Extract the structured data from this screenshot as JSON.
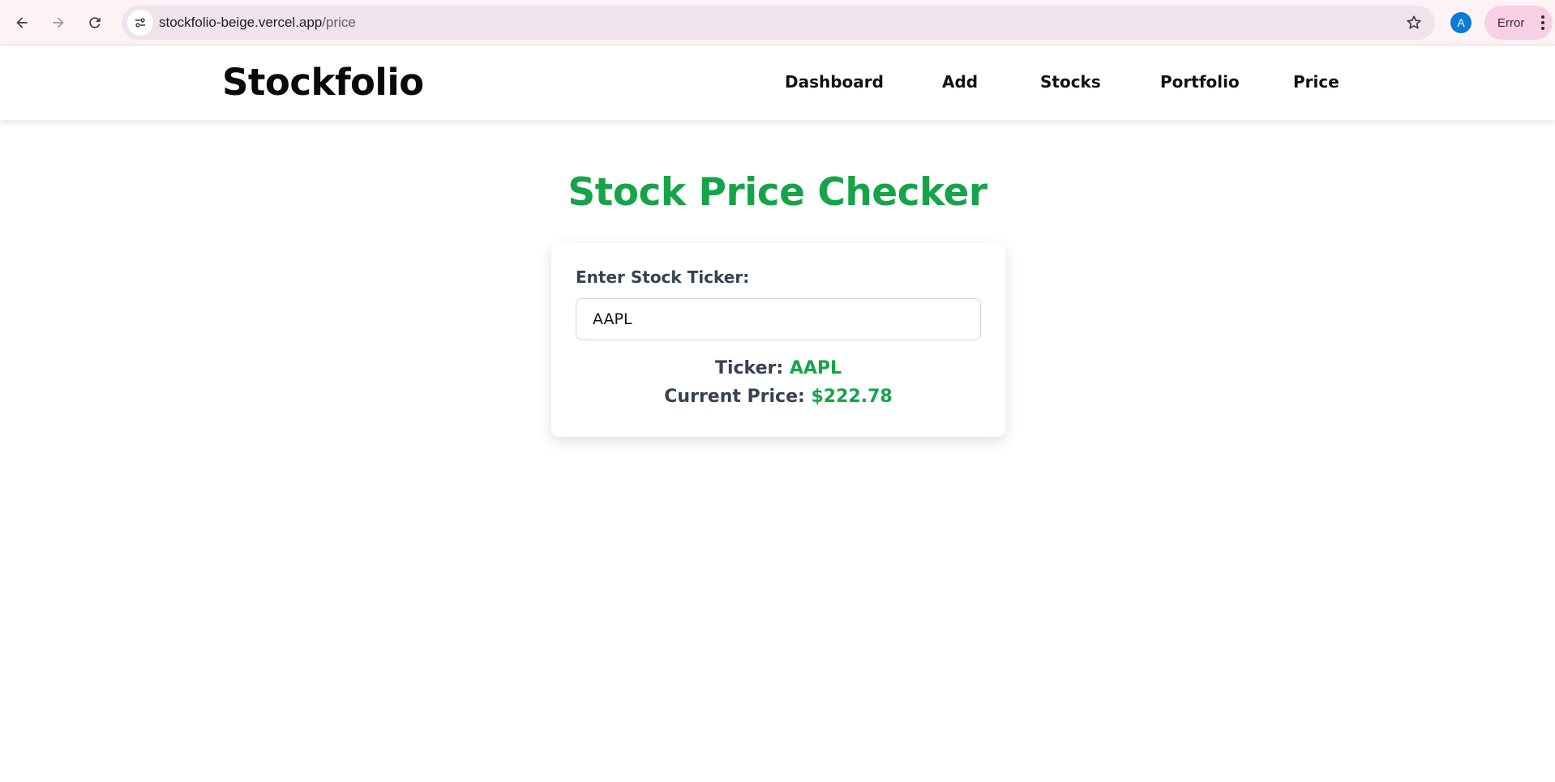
{
  "browser": {
    "url_host": "stockfolio-beige.vercel.app",
    "url_path": "/price",
    "avatar_letter": "A",
    "error_label": "Error"
  },
  "header": {
    "brand": "Stockfolio",
    "nav": [
      {
        "label": "Dashboard"
      },
      {
        "label": "Add"
      },
      {
        "label": "Stocks"
      },
      {
        "label": "Portfolio"
      },
      {
        "label": "Price"
      }
    ]
  },
  "main": {
    "title": "Stock Price Checker",
    "input_label": "Enter Stock Ticker:",
    "input_value": "AAPL",
    "ticker_label": "Ticker:",
    "ticker_value": "AAPL",
    "price_label": "Current Price:",
    "price_value": "$222.78"
  },
  "colors": {
    "accent_green": "#16a34a",
    "label_gray": "#374151",
    "browser_bar": "#fdf2f4",
    "error_chip": "#f8cfe3",
    "avatar_blue": "#0b7bd6"
  },
  "icons": [
    "back-arrow-icon",
    "forward-arrow-icon",
    "reload-icon",
    "site-settings-icon",
    "bookmark-star-icon",
    "more-vert-icon"
  ]
}
